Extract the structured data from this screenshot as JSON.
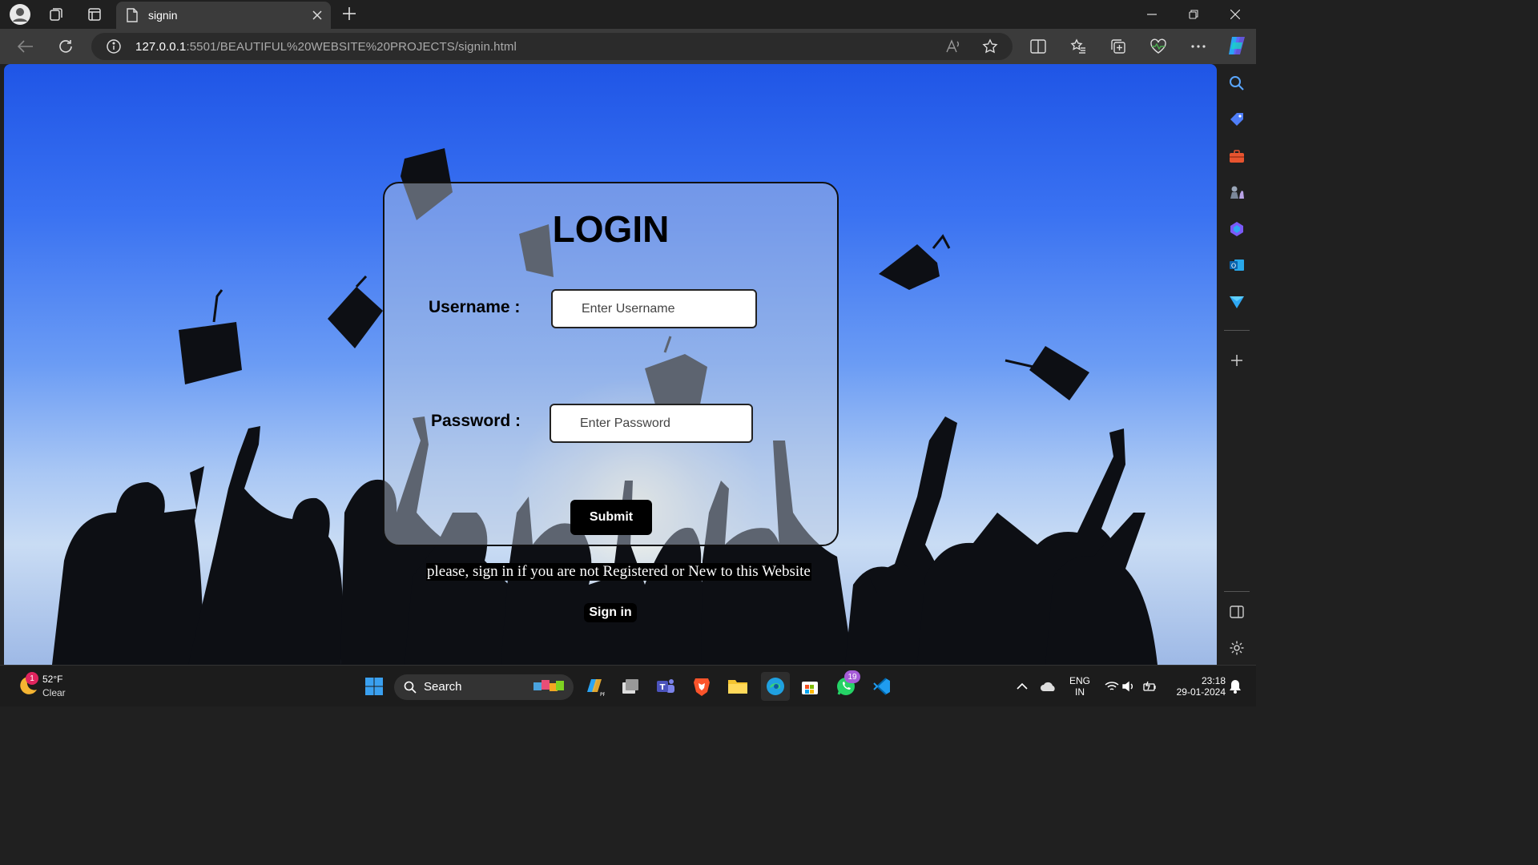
{
  "browser": {
    "tab_title": "signin",
    "url_host": "127.0.0.1",
    "url_path": ":5501/BEAUTIFUL%20WEBSITE%20PROJECTS/signin.html"
  },
  "page": {
    "login_title": "LOGIN",
    "username_label": "Username :",
    "username_placeholder": "Enter Username",
    "password_label": "Password :",
    "password_placeholder": "Enter Password",
    "submit_label": "Submit",
    "note_text": "please, sign in if you are not Registered or New to this Website",
    "signin_label": "Sign in"
  },
  "taskbar": {
    "weather_temp": "52°F",
    "weather_desc": "Clear",
    "weather_badge": "1",
    "search_label": "Search",
    "whatsapp_badge": "19",
    "lang_line1": "ENG",
    "lang_line2": "IN",
    "time": "23:18",
    "date": "29-01-2024"
  },
  "colors": {
    "sky_top": "#1f55e6",
    "sky_bottom": "#c9dcf4",
    "browser_chrome": "#202020",
    "button_black": "#000000"
  }
}
